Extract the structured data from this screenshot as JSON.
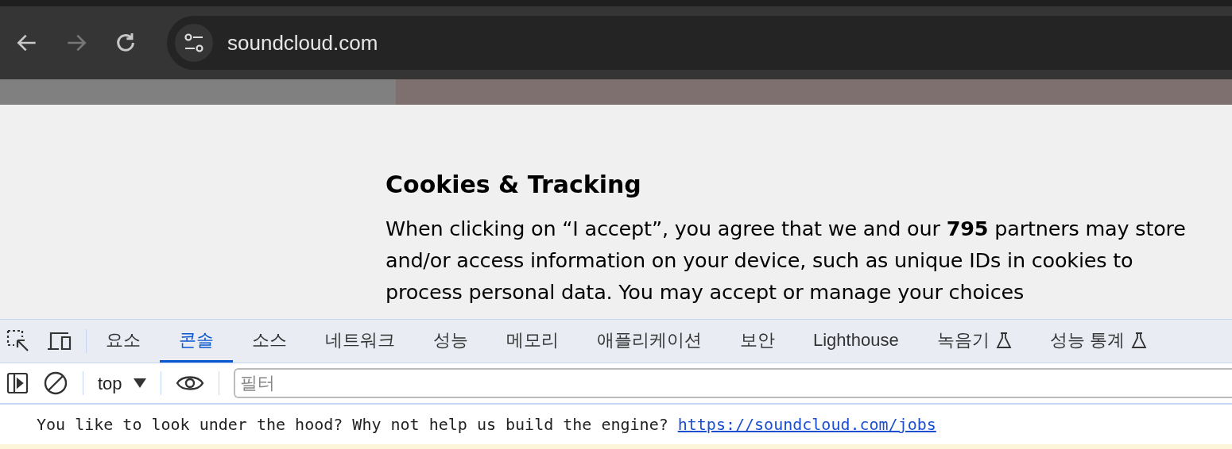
{
  "browser": {
    "url": "soundcloud.com"
  },
  "page": {
    "heading": "Cookies & Tracking",
    "paragraph": "When clicking on “I accept”, you agree that we and our **795** partners may store and/or access information on your device, such as unique IDs in cookies to process personal data. You may accept or manage your choices"
  },
  "devtools": {
    "tabs": [
      {
        "label": "요소",
        "selected": false,
        "experimental": false
      },
      {
        "label": "콘솔",
        "selected": true,
        "experimental": false
      },
      {
        "label": "소스",
        "selected": false,
        "experimental": false
      },
      {
        "label": "네트워크",
        "selected": false,
        "experimental": false
      },
      {
        "label": "성능",
        "selected": false,
        "experimental": false
      },
      {
        "label": "메모리",
        "selected": false,
        "experimental": false
      },
      {
        "label": "애플리케이션",
        "selected": false,
        "experimental": false
      },
      {
        "label": "보안",
        "selected": false,
        "experimental": false
      },
      {
        "label": "Lighthouse",
        "selected": false,
        "experimental": false
      },
      {
        "label": "녹음기",
        "selected": false,
        "experimental": true
      },
      {
        "label": "성능 통계",
        "selected": false,
        "experimental": true
      }
    ],
    "context": "top",
    "filter": {
      "placeholder": "필터"
    },
    "message": {
      "text": "You like to look under the hood? Why not help us build the engine?",
      "link": "https://soundcloud.com/jobs"
    }
  }
}
